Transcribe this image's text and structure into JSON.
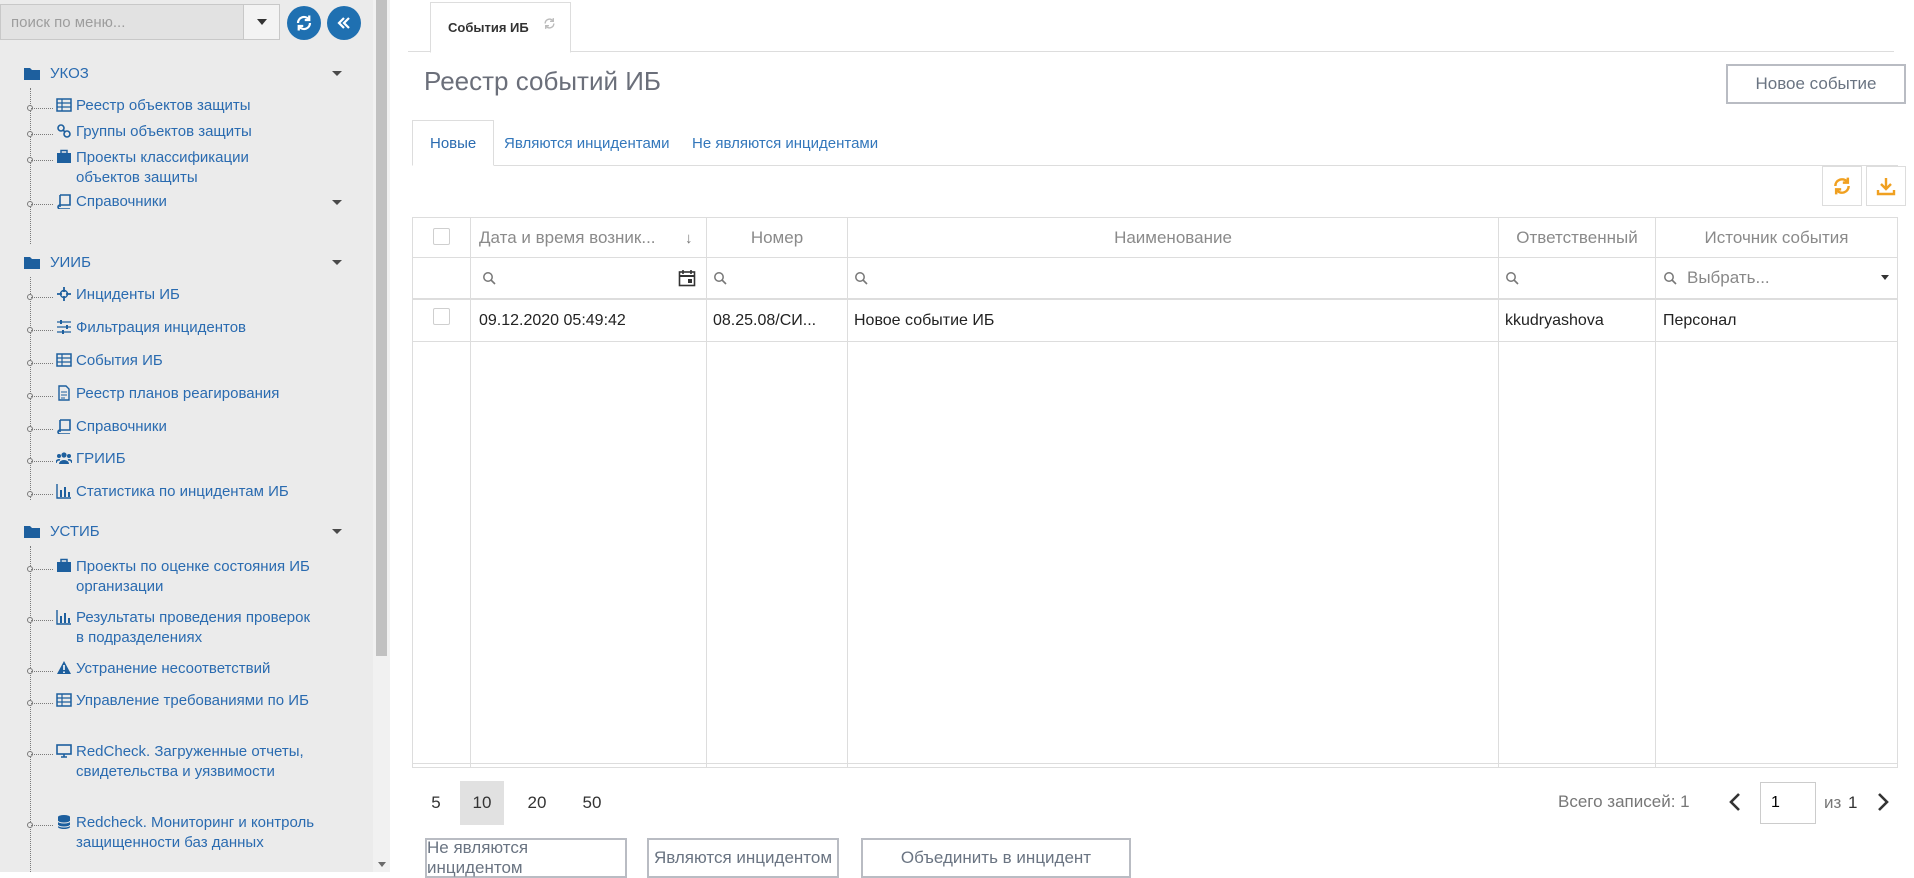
{
  "sidebar": {
    "search": {
      "placeholder": "поиск по меню..."
    },
    "groups": [
      {
        "label": "УКОЗ",
        "items": [
          {
            "label": "Реестр объектов защиты",
            "icon": "table-icon"
          },
          {
            "label": "Группы объектов защиты",
            "icon": "link-icon"
          },
          {
            "label": "Проекты классификации объектов защиты",
            "icon": "briefcase-icon"
          },
          {
            "label": "Справочники",
            "icon": "book-icon"
          }
        ]
      },
      {
        "label": "УИИБ",
        "items": [
          {
            "label": "Инциденты ИБ",
            "icon": "crosshair-icon"
          },
          {
            "label": "Фильтрация инцидентов",
            "icon": "sliders-icon"
          },
          {
            "label": "События ИБ",
            "icon": "table-icon"
          },
          {
            "label": "Реестр планов реагирования",
            "icon": "document-icon"
          },
          {
            "label": "Справочники",
            "icon": "book-icon"
          },
          {
            "label": "ГРИИБ",
            "icon": "users-icon"
          },
          {
            "label": "Статистика по инцидентам ИБ",
            "icon": "bar-chart-icon"
          }
        ]
      },
      {
        "label": "УСТИБ",
        "items": [
          {
            "label": "Проекты по оценке состояния ИБ организации",
            "icon": "briefcase-icon"
          },
          {
            "label": "Результаты проведения проверок в подразделениях",
            "icon": "bar-chart-icon"
          },
          {
            "label": "Устранение несоответствий",
            "icon": "warning-icon"
          },
          {
            "label": "Управление требованиями по ИБ",
            "icon": "table-icon"
          },
          {
            "label": "RedCheck. Загруженные отчеты, свидетельства и уязвимости",
            "icon": "monitor-icon"
          },
          {
            "label": "Redcheck. Мониторинг и контроль защищенности баз данных",
            "icon": "database-icon"
          }
        ]
      }
    ]
  },
  "main": {
    "page_tab": "События ИБ",
    "title": "Реестр событий ИБ",
    "new_event_button": "Новое событие",
    "tabs": [
      "Новые",
      "Являются инцидентами",
      "Не являются инцидентами"
    ],
    "active_tab": "Новые",
    "colors": {
      "accent": "#2a6bb0",
      "action_orange": "#f0a020",
      "round_btn": "#1f70b1"
    }
  },
  "grid": {
    "columns": [
      "Дата и время возник...",
      "Номер",
      "Наименование",
      "Ответственный",
      "Источник события"
    ],
    "sort_indicator": "↓",
    "filters": {
      "source_placeholder": "Выбрать..."
    },
    "rows": [
      {
        "datetime": "09.12.2020 05:49:42",
        "number": "08.25.08/СИ...",
        "name": "Новое событие ИБ",
        "responsible": "kkudryashova",
        "source": "Персонал"
      }
    ]
  },
  "pager": {
    "sizes": [
      "5",
      "10",
      "20",
      "50"
    ],
    "active_size": "10",
    "total_label": "Всего записей: 1",
    "current_page": "1",
    "of_label": "из",
    "page_count": "1"
  },
  "actions": {
    "not_incident": "Не являются инцидентом",
    "is_incident": "Являются инцидентом",
    "merge": "Объединить в инцидент"
  }
}
